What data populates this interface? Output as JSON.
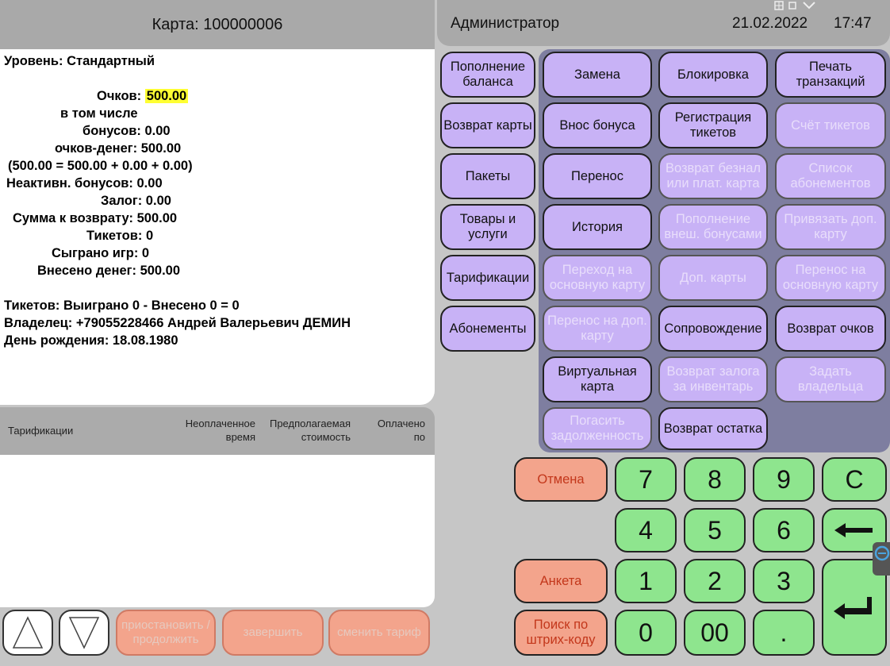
{
  "card": {
    "title": "Карта: 100000006",
    "level": "Уровень: Стандартный",
    "points_label": "Очков:",
    "points_value": "500.00",
    "including": "в том числе",
    "bonuses": "бонусов: 0.00",
    "points_money": "очков-денег: 500.00",
    "formula": "(500.00 = 500.00 + 0.00 + 0.00)",
    "inactive_bonuses": "Неактивн. бонусов: 0.00",
    "deposit": "Залог: 0.00",
    "refund_sum": "Сумма к возврату: 500.00",
    "tickets": "Тикетов: 0",
    "games_played": "Сыграно игр: 0",
    "money_deposited": "Внесено денег: 500.00",
    "tickets_summary": "Тикетов: Выиграно 0 - Внесено 0 = 0",
    "owner": "Владелец: +79055228466 Андрей Валерьевич ДЕМИН",
    "birthday": "День рождения: 18.08.1980"
  },
  "tariff_table": {
    "col1": "Тарификации",
    "col2": "Неоплаченное время",
    "col3": "Предполагаемая стоимость",
    "col4": "Оплачено по"
  },
  "bottom_left": {
    "pause": "приостановить / продолжить",
    "finish": "завершить",
    "change_tariff": "сменить тариф"
  },
  "top_bar": {
    "user": "Администратор",
    "date": "21.02.2022",
    "time": "17:47"
  },
  "left_menu": {
    "topup": "Пополнение баланса",
    "card_return": "Возврат карты",
    "packages": "Пакеты",
    "goods": "Товары и услуги",
    "tariffs": "Тарификации",
    "subscriptions": "Абонементы"
  },
  "ops": {
    "replace": "Замена",
    "block": "Блокировка",
    "print_tx": "Печать транзакций",
    "bonus_deposit": "Внос бонуса",
    "ticket_reg": "Регистрация тикетов",
    "ticket_count": "Счёт тикетов",
    "transfer": "Перенос",
    "noncash_return": "Возврат безнал или плат. карта",
    "subs_list": "Список абонементов",
    "history": "История",
    "ext_bonus_topup": "Пополнение внеш. бонусами",
    "bind_extra": "Привязать доп. карту",
    "to_main": "Переход на основную карту",
    "extra_cards": "Доп. карты",
    "transfer_to_main": "Перенос на основную карту",
    "transfer_to_extra": "Перенос на доп. карту",
    "escort": "Сопровождение",
    "points_return": "Возврат очков",
    "virtual_card": "Виртуальная карта",
    "deposit_return": "Возврат залога за инвентарь",
    "set_owner": "Задать владельца",
    "pay_debt": "Погасить задолженность",
    "balance_return": "Возврат остатка"
  },
  "keypad": {
    "cancel": "Отмена",
    "form": "Анкета",
    "barcode": "Поиск по штрих-коду",
    "k7": "7",
    "k8": "8",
    "k9": "9",
    "kc": "C",
    "k4": "4",
    "k5": "5",
    "k6": "6",
    "k1": "1",
    "k2": "2",
    "k3": "3",
    "k0": "0",
    "k00": "00",
    "kdot": "."
  }
}
